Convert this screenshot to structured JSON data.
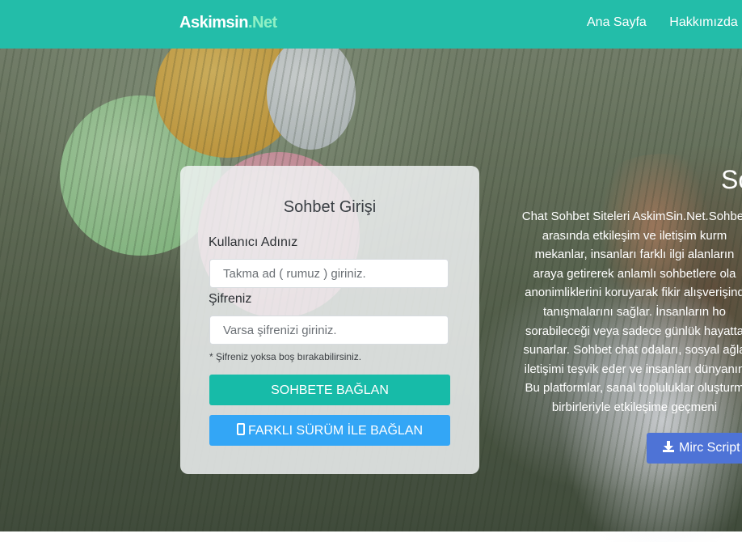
{
  "navbar": {
    "brand_main": "Askimsin",
    "brand_tld": ".Net",
    "links": [
      "Ana Sayfa",
      "Hakkımızda"
    ],
    "color": "#23bda9"
  },
  "login": {
    "title": "Sohbet Girişi",
    "username_label": "Kullanıcı Adınız",
    "username_placeholder": "Takma ad ( rumuz ) giriniz.",
    "username_value": "",
    "password_label": "Şifreniz",
    "password_placeholder": "Varsa şifrenizi giriniz.",
    "password_value": "",
    "note": "* Şifreniz yoksa boş bırakabilirsiniz.",
    "connect_button": "SOHBETE BAĞLAN",
    "alt_button": "FARKLI SÜRÜM İLE BAĞLAN",
    "connect_color": "#17bba8",
    "alt_color": "#33a6f6"
  },
  "hero": {
    "heading": "So",
    "lines": [
      "Chat Sohbet Siteleri AskimSin.Net.Sohbet",
      "arasında etkileşim ve iletişim kurm",
      "mekanlar, insanları farklı ilgi alanların",
      "araya getirerek anlamlı sohbetlere ola",
      "anonimliklerini koruyarak fikir alışverişind",
      "tanışmalarını sağlar. İnsanların ho",
      "sorabileceği veya sadece günlük hayatta",
      "sunarlar. Sohbet chat odaları, sosyal ağla",
      "iletişimi teşvik eder ve insanları dünyanın",
      "Bu platformlar, sanal topluluklar oluşturm",
      "birbirleriyle etkileşime geçmeni"
    ],
    "download_button": "Mirc Script",
    "download_color": "#4e73d6"
  },
  "icons": {
    "phone": "mobile-phone-icon",
    "download": "download-icon"
  }
}
